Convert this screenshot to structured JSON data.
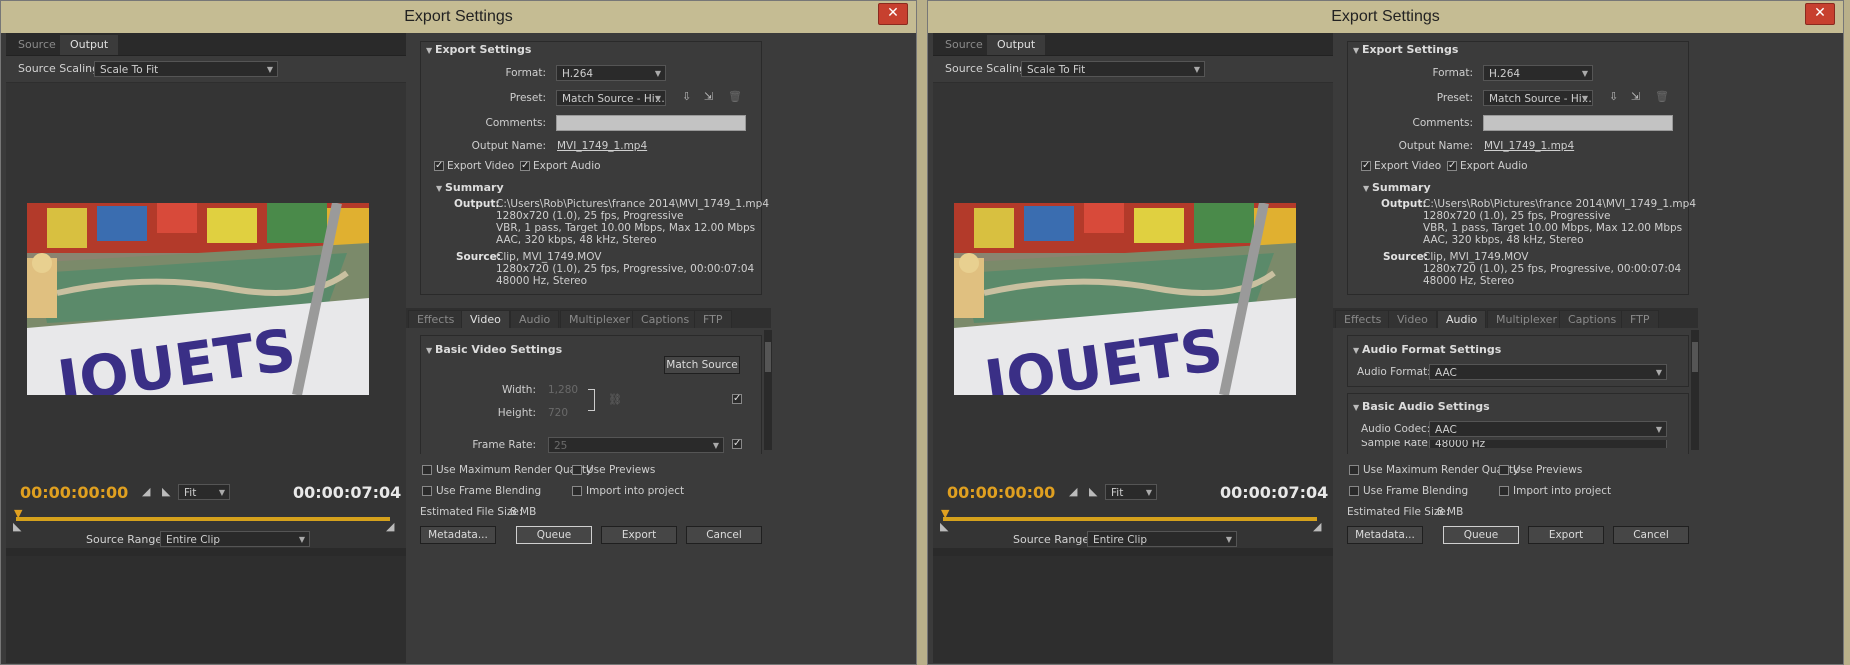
{
  "windows": [
    {
      "id": "left",
      "title": "Export Settings",
      "close": "✕",
      "tabs": [
        "Source",
        "Output"
      ],
      "source_scaling_label": "Source Scaling:",
      "source_scaling_value": "Scale To Fit",
      "timecode_current": "00:00:00:00",
      "fit_value": "Fit",
      "timecode_total": "00:00:07:04",
      "source_range_label": "Source Range:",
      "source_range_value": "Entire Clip",
      "export_settings": {
        "header": "Export Settings",
        "format_label": "Format:",
        "format": "H.264",
        "preset_label": "Preset:",
        "preset": "Match Source - Hi...",
        "comments_label": "Comments:",
        "output_name_label": "Output Name:",
        "output_name": "MVI_1749_1.mp4",
        "export_video": "Export Video",
        "export_audio": "Export Audio",
        "summary_header": "Summary",
        "output_label": "Output:",
        "output_lines": [
          "C:\\Users\\Rob\\Pictures\\france 2014\\MVI_1749_1.mp4",
          "1280x720 (1.0), 25 fps, Progressive",
          "VBR, 1 pass, Target 10.00 Mbps, Max 12.00 Mbps",
          "AAC, 320 kbps, 48 kHz, Stereo"
        ],
        "source_label": "Source:",
        "source_lines": [
          "Clip, MVI_1749.MOV",
          "1280x720 (1.0), 25 fps, Progressive, 00:00:07:04",
          "48000 Hz, Stereo"
        ]
      },
      "subtabs": [
        "Effects",
        "Video",
        "Audio",
        "Multiplexer",
        "Captions",
        "FTP"
      ],
      "active_subtab": "Video",
      "video": {
        "header": "Basic Video Settings",
        "match_source": "Match Source",
        "width_label": "Width:",
        "width": "1,280",
        "height_label": "Height:",
        "height": "720",
        "framerate_label": "Frame Rate:",
        "framerate": "25"
      },
      "bottom": {
        "max_render": "Use Maximum Render Quality",
        "previews": "Use Previews",
        "frame_blending": "Use Frame Blending",
        "import": "Import into project",
        "est_label": "Estimated File Size:",
        "est_value": "8 MB",
        "metadata": "Metadata...",
        "queue": "Queue",
        "export": "Export",
        "cancel": "Cancel"
      }
    },
    {
      "id": "right",
      "title": "Export Settings",
      "close": "✕",
      "tabs": [
        "Source",
        "Output"
      ],
      "source_scaling_label": "Source Scaling:",
      "source_scaling_value": "Scale To Fit",
      "timecode_current": "00:00:00:00",
      "fit_value": "Fit",
      "timecode_total": "00:00:07:04",
      "source_range_label": "Source Range:",
      "source_range_value": "Entire Clip",
      "export_settings": {
        "header": "Export Settings",
        "format_label": "Format:",
        "format": "H.264",
        "preset_label": "Preset:",
        "preset": "Match Source - Hi...",
        "comments_label": "Comments:",
        "output_name_label": "Output Name:",
        "output_name": "MVI_1749_1.mp4",
        "export_video": "Export Video",
        "export_audio": "Export Audio",
        "summary_header": "Summary",
        "output_label": "Output:",
        "output_lines": [
          "C:\\Users\\Rob\\Pictures\\france 2014\\MVI_1749_1.mp4",
          "1280x720 (1.0), 25 fps, Progressive",
          "VBR, 1 pass, Target 10.00 Mbps, Max 12.00 Mbps",
          "AAC, 320 kbps, 48 kHz, Stereo"
        ],
        "source_label": "Source:",
        "source_lines": [
          "Clip, MVI_1749.MOV",
          "1280x720 (1.0), 25 fps, Progressive, 00:00:07:04",
          "48000 Hz, Stereo"
        ]
      },
      "subtabs": [
        "Effects",
        "Video",
        "Audio",
        "Multiplexer",
        "Captions",
        "FTP"
      ],
      "active_subtab": "Audio",
      "audio": {
        "format_header": "Audio Format Settings",
        "format_label": "Audio Format:",
        "format": "AAC",
        "basic_header": "Basic Audio Settings",
        "codec_label": "Audio Codec:",
        "codec": "AAC",
        "rate_label": "Sample Rate:",
        "rate": "48000 Hz"
      },
      "bottom": {
        "max_render": "Use Maximum Render Quality",
        "previews": "Use Previews",
        "frame_blending": "Use Frame Blending",
        "import": "Import into project",
        "est_label": "Estimated File Size:",
        "est_value": "8 MB",
        "metadata": "Metadata...",
        "queue": "Queue",
        "export": "Export",
        "cancel": "Cancel"
      }
    }
  ],
  "colors": {
    "accent": "#e0a020",
    "title_bar": "#c5bc93",
    "close": "#c7402f",
    "panel": "#3b3b3b"
  }
}
